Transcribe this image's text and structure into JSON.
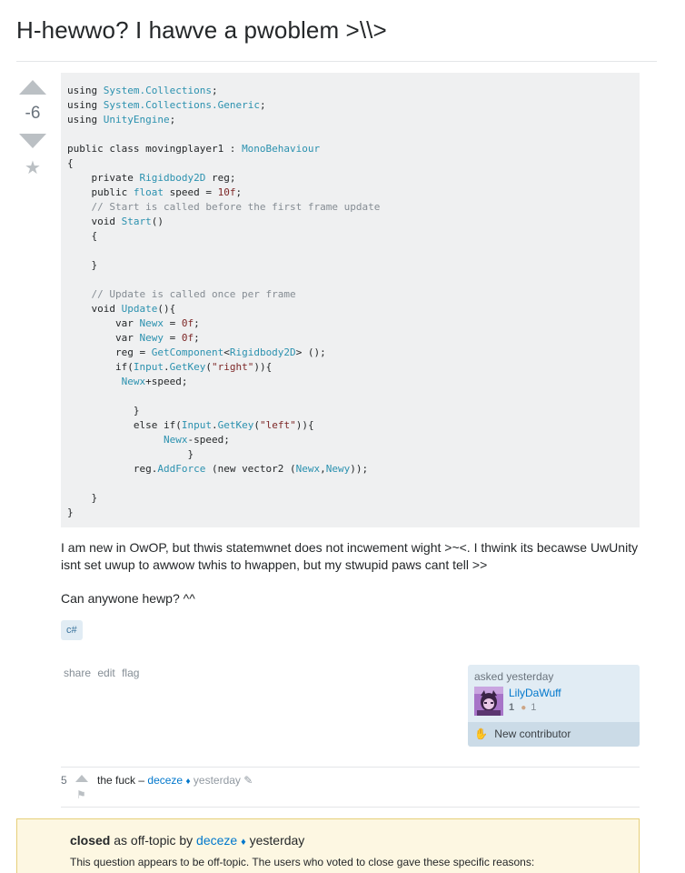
{
  "question": {
    "title": "H-hewwo? I hawve a pwoblem >\\\\>",
    "score": "-6",
    "body_paragraph_1": "I am new in OwOP, but thwis statemwnet does not incwement wight >~<. I thwink its becawse UwUnity isnt set uwup to awwow twhis to hwappen, but my stwupid paws cant tell >>",
    "body_paragraph_2": "Can anywone hewp? ^^",
    "tag": "c#"
  },
  "code_lines": [
    [
      {
        "t": "using "
      },
      {
        "t": "System.Collections",
        "c": "tp"
      },
      {
        "t": ";"
      }
    ],
    [
      {
        "t": "using "
      },
      {
        "t": "System.Collections.Generic",
        "c": "tp"
      },
      {
        "t": ";"
      }
    ],
    [
      {
        "t": "using "
      },
      {
        "t": "UnityEngine",
        "c": "tp"
      },
      {
        "t": ";"
      }
    ],
    [],
    [
      {
        "t": "public class movingplayer1 : "
      },
      {
        "t": "MonoBehaviour",
        "c": "tp"
      }
    ],
    [
      {
        "t": "{"
      }
    ],
    [
      {
        "t": "    private "
      },
      {
        "t": "Rigidbody2D",
        "c": "tp"
      },
      {
        "t": " reg;"
      }
    ],
    [
      {
        "t": "    public "
      },
      {
        "t": "float",
        "c": "tp"
      },
      {
        "t": " speed = "
      },
      {
        "t": "10f",
        "c": "nm"
      },
      {
        "t": ";"
      }
    ],
    [
      {
        "t": "    // Start is called before the first frame update",
        "c": "cm"
      }
    ],
    [
      {
        "t": "    void "
      },
      {
        "t": "Start",
        "c": "tp"
      },
      {
        "t": "()"
      }
    ],
    [
      {
        "t": "    {"
      }
    ],
    [],
    [
      {
        "t": "    }"
      }
    ],
    [],
    [
      {
        "t": "    // Update is called once per frame",
        "c": "cm"
      }
    ],
    [
      {
        "t": "    void "
      },
      {
        "t": "Update",
        "c": "tp"
      },
      {
        "t": "(){"
      }
    ],
    [
      {
        "t": "        var "
      },
      {
        "t": "Newx",
        "c": "tp"
      },
      {
        "t": " = "
      },
      {
        "t": "0f",
        "c": "nm"
      },
      {
        "t": ";"
      }
    ],
    [
      {
        "t": "        var "
      },
      {
        "t": "Newy",
        "c": "tp"
      },
      {
        "t": " = "
      },
      {
        "t": "0f",
        "c": "nm"
      },
      {
        "t": ";"
      }
    ],
    [
      {
        "t": "        reg = "
      },
      {
        "t": "GetComponent",
        "c": "tp"
      },
      {
        "t": "<"
      },
      {
        "t": "Rigidbody2D",
        "c": "tp"
      },
      {
        "t": "> ();"
      }
    ],
    [
      {
        "t": "        if("
      },
      {
        "t": "Input",
        "c": "tp"
      },
      {
        "t": "."
      },
      {
        "t": "GetKey",
        "c": "tp"
      },
      {
        "t": "("
      },
      {
        "t": "\"right\"",
        "c": "st"
      },
      {
        "t": ")){"
      }
    ],
    [
      {
        "t": "         "
      },
      {
        "t": "Newx",
        "c": "tp"
      },
      {
        "t": "+speed;"
      }
    ],
    [],
    [
      {
        "t": "           }"
      }
    ],
    [
      {
        "t": "           else if("
      },
      {
        "t": "Input",
        "c": "tp"
      },
      {
        "t": "."
      },
      {
        "t": "GetKey",
        "c": "tp"
      },
      {
        "t": "("
      },
      {
        "t": "\"left\"",
        "c": "st"
      },
      {
        "t": ")){"
      }
    ],
    [
      {
        "t": "                "
      },
      {
        "t": "Newx",
        "c": "tp"
      },
      {
        "t": "-speed;"
      }
    ],
    [
      {
        "t": "                    }"
      }
    ],
    [
      {
        "t": "           reg."
      },
      {
        "t": "AddForce",
        "c": "tp"
      },
      {
        "t": " (new vector2 ("
      },
      {
        "t": "Newx",
        "c": "tp"
      },
      {
        "t": ","
      },
      {
        "t": "Newy",
        "c": "tp"
      },
      {
        "t": "));"
      }
    ],
    [],
    [
      {
        "t": "    }"
      }
    ],
    [
      {
        "t": "}"
      }
    ]
  ],
  "post_menu": {
    "share": "share",
    "edit": "edit",
    "flag": "flag"
  },
  "owner": {
    "asked": "asked yesterday",
    "username": "LilyDaWuff",
    "reputation": "1",
    "bronze_badges": "1",
    "new_contributor": "New contributor"
  },
  "comment": {
    "score": "5",
    "text": "the fuck",
    "separator": "–",
    "user": "deceze",
    "date": "yesterday"
  },
  "closed_notice": {
    "status": "closed",
    "reason_prefix": "as off-topic by",
    "user": "deceze",
    "date": "yesterday",
    "explanation": "This question appears to be off-topic. The users who voted to close gave these specific reasons:"
  },
  "icons": {
    "upvote": "up-arrow-icon",
    "downvote": "down-arrow-icon",
    "favorite": "star-icon",
    "moderator": "diamond-icon",
    "edit": "pencil-icon",
    "flag": "flag-icon",
    "new_contributor": "wave-hand-icon"
  },
  "colors": {
    "link": "#0077cc",
    "code_background": "#eff0f1",
    "code_type": "#2b91af",
    "code_comment": "#858c93",
    "tag_background": "#e1ecf4",
    "notice_background": "#fdf7e2",
    "notice_border": "#e6cf79"
  }
}
